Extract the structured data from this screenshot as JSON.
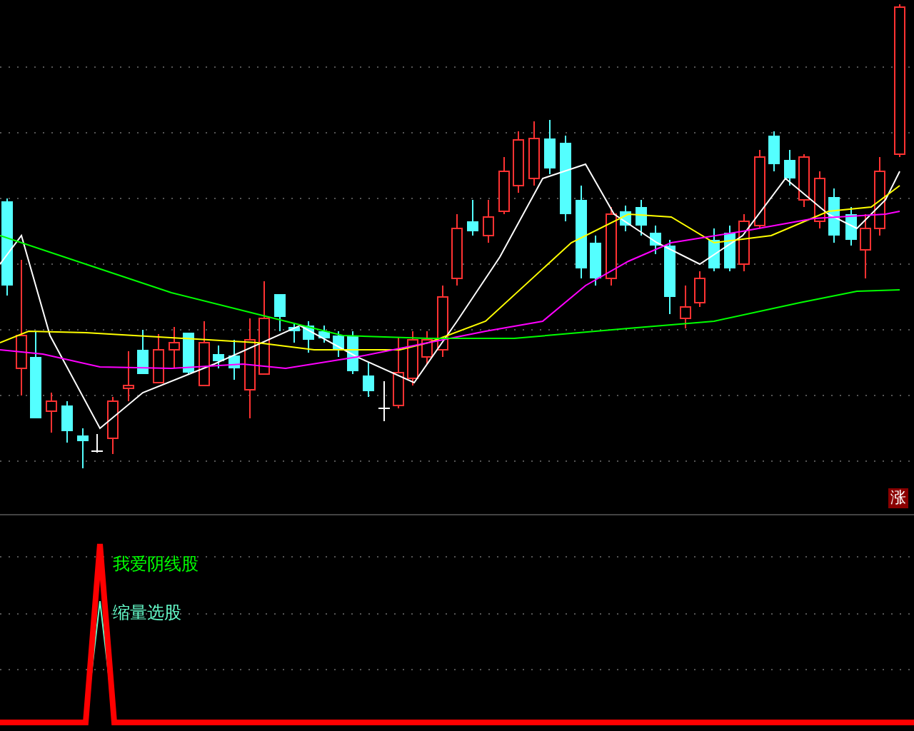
{
  "main_chart": {
    "badge": "涨"
  },
  "indicator": {
    "labels": [
      {
        "text": "我爱阴线股",
        "color": "#00ff00"
      },
      {
        "text": "缩量选股",
        "color": "#66ffcc"
      }
    ]
  }
}
